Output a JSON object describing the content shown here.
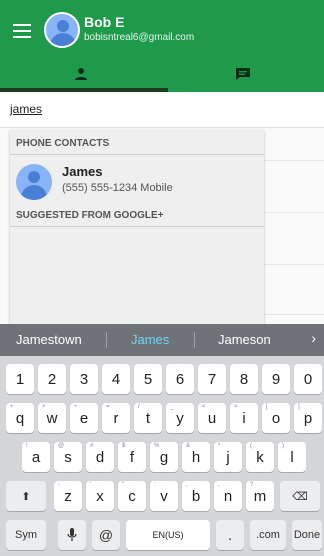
{
  "account": {
    "name": "Bob E",
    "email": "bobisntreal6@gmail.com"
  },
  "icons": {
    "menu": "menu-icon",
    "contacts_tab": "person-icon",
    "messages_tab": "chat-icon"
  },
  "search": {
    "value": "james"
  },
  "dropdown": {
    "phone_header": "PHONE CONTACTS",
    "contact": {
      "name": "James",
      "detail": "(555) 555-1234 Mobile"
    },
    "google_header": "SUGGESTED FROM GOOGLE+"
  },
  "keyboard": {
    "suggestions": [
      "Jamestown",
      "James",
      "Jameson"
    ],
    "more_suggestions_glyph": "›",
    "row_numbers": [
      "1",
      "2",
      "3",
      "4",
      "5",
      "6",
      "7",
      "8",
      "9",
      "0"
    ],
    "row_qwerty": [
      {
        "key": "q",
        "hint": "+"
      },
      {
        "key": "w",
        "hint": "×"
      },
      {
        "key": "e",
        "hint": "÷"
      },
      {
        "key": "r",
        "hint": "="
      },
      {
        "key": "t",
        "hint": "/"
      },
      {
        "key": "y",
        "hint": "_"
      },
      {
        "key": "u",
        "hint": "<"
      },
      {
        "key": "i",
        "hint": ">"
      },
      {
        "key": "o",
        "hint": "["
      },
      {
        "key": "p",
        "hint": "]"
      }
    ],
    "row_asdf": [
      {
        "key": "a",
        "hint": "!"
      },
      {
        "key": "s",
        "hint": "@"
      },
      {
        "key": "d",
        "hint": "#"
      },
      {
        "key": "f",
        "hint": "$"
      },
      {
        "key": "g",
        "hint": "%"
      },
      {
        "key": "h",
        "hint": "&"
      },
      {
        "key": "j",
        "hint": "*"
      },
      {
        "key": "k",
        "hint": "("
      },
      {
        "key": "l",
        "hint": ")"
      }
    ],
    "row_zxcv": [
      {
        "key": "z",
        "hint": "-"
      },
      {
        "key": "x",
        "hint": "'"
      },
      {
        "key": "c",
        "hint": "\""
      },
      {
        "key": "v",
        "hint": ":"
      },
      {
        "key": "b",
        "hint": ";"
      },
      {
        "key": "n",
        "hint": ","
      },
      {
        "key": "m",
        "hint": "?"
      }
    ],
    "shift_glyph": "⬆",
    "backspace_glyph": "⌫",
    "sym_label": "Sym",
    "mic_glyph": "🎤",
    "at_label": "@",
    "space_label": "EN(US)",
    "period_label": ".",
    "com_label": ".com",
    "done_label": "Done"
  },
  "colors": {
    "app_bar": "#1f9a4b",
    "tab_indicator": "#1a3d24",
    "suggestion_highlight": "#6fd4f2"
  }
}
